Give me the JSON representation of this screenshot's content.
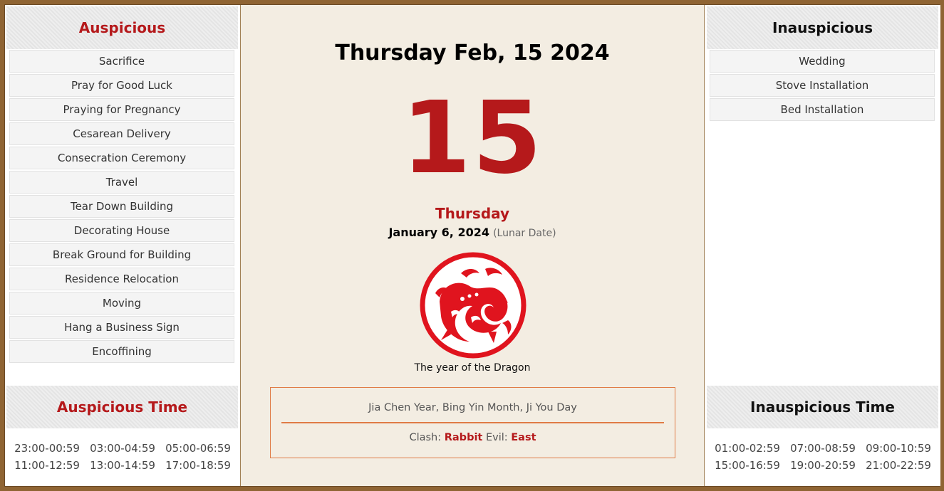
{
  "colors": {
    "accent_red": "#b5191b",
    "frame_brown": "#8f6433",
    "box_orange": "#e07b45",
    "center_bg": "#f3ede2"
  },
  "auspicious": {
    "title": "Auspicious",
    "items": [
      "Sacrifice",
      "Pray for Good Luck",
      "Praying for Pregnancy",
      "Cesarean Delivery",
      "Consecration Ceremony",
      "Travel",
      "Tear Down Building",
      "Decorating House",
      "Break Ground for Building",
      "Residence Relocation",
      "Moving",
      "Hang a Business Sign",
      "Encoffining"
    ]
  },
  "auspicious_time": {
    "title": "Auspicious Time",
    "slots": [
      "23:00-00:59",
      "03:00-04:59",
      "05:00-06:59",
      "11:00-12:59",
      "13:00-14:59",
      "17:00-18:59"
    ]
  },
  "inauspicious": {
    "title": "Inauspicious",
    "items": [
      "Wedding",
      "Stove Installation",
      "Bed Installation"
    ]
  },
  "inauspicious_time": {
    "title": "Inauspicious Time",
    "slots": [
      "01:00-02:59",
      "07:00-08:59",
      "09:00-10:59",
      "15:00-16:59",
      "19:00-20:59",
      "21:00-22:59"
    ]
  },
  "center": {
    "full_date": "Thursday Feb, 15 2024",
    "day_number": "15",
    "weekday": "Thursday",
    "lunar_date": "January 6, 2024",
    "lunar_note": "(Lunar Date)",
    "zodiac_icon": "dragon-papercut-icon",
    "zodiac_caption": "The year of the Dragon",
    "ganzhi": "Jia Chen Year, Bing Yin Month, Ji You Day",
    "clash_label": "Clash:",
    "clash_value": "Rabbit",
    "evil_label": "Evil:",
    "evil_value": "East"
  }
}
